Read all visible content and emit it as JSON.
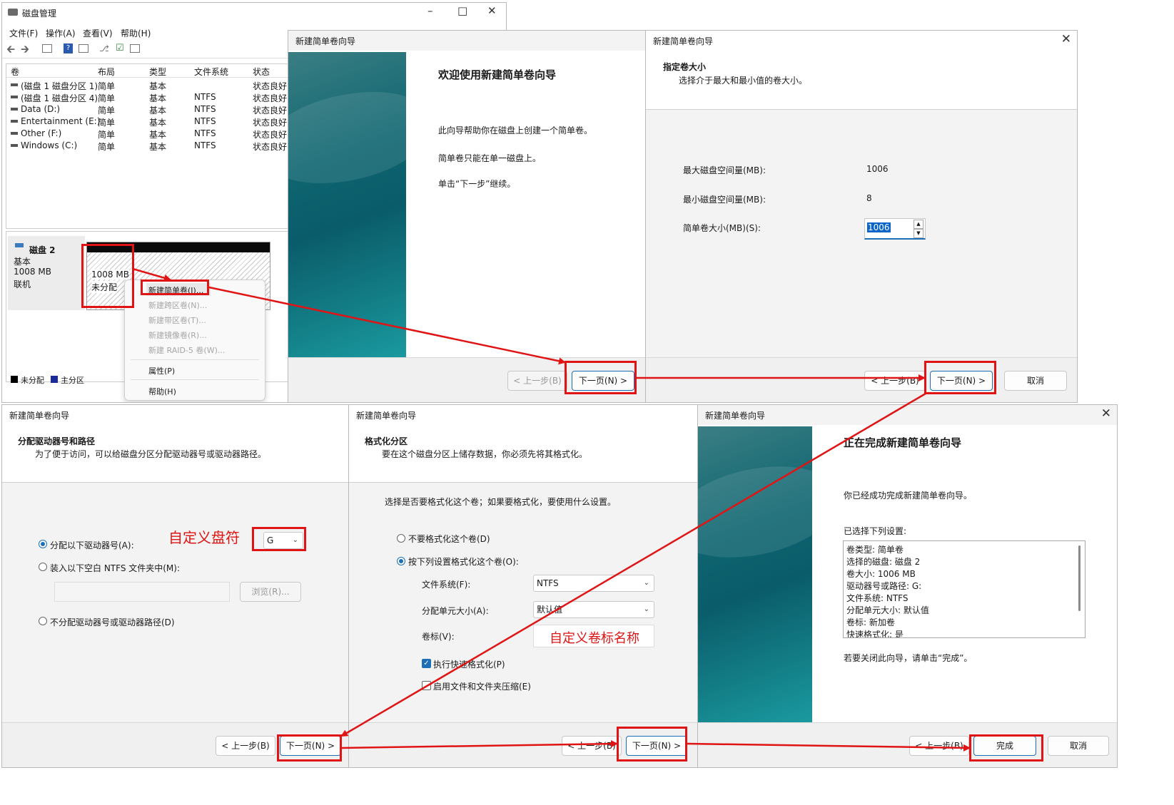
{
  "disk_mgmt": {
    "title": "磁盘管理",
    "menu": [
      "文件(F)",
      "操作(A)",
      "查看(V)",
      "帮助(H)"
    ],
    "columns": [
      "卷",
      "布局",
      "类型",
      "文件系统",
      "状态"
    ],
    "rows": [
      {
        "vol": "(磁盘 1 磁盘分区 1)",
        "layout": "简单",
        "type": "基本",
        "fs": "",
        "status": "状态良好"
      },
      {
        "vol": "(磁盘 1 磁盘分区 4)",
        "layout": "简单",
        "type": "基本",
        "fs": "NTFS",
        "status": "状态良好"
      },
      {
        "vol": "Data (D:)",
        "layout": "简单",
        "type": "基本",
        "fs": "NTFS",
        "status": "状态良好"
      },
      {
        "vol": "Entertainment (E:)",
        "layout": "简单",
        "type": "基本",
        "fs": "NTFS",
        "status": "状态良好"
      },
      {
        "vol": "Other (F:)",
        "layout": "简单",
        "type": "基本",
        "fs": "NTFS",
        "status": "状态良好"
      },
      {
        "vol": "Windows (C:)",
        "layout": "简单",
        "type": "基本",
        "fs": "NTFS",
        "status": "状态良好"
      }
    ],
    "disk": {
      "name": "磁盘 2",
      "kind": "基本",
      "size": "1008 MB",
      "state": "联机",
      "part_size": "1008 MB",
      "part_state": "未分配"
    },
    "legend": [
      "未分配",
      "主分区"
    ],
    "context_menu": [
      {
        "label": "新建简单卷(I)...",
        "enabled": true
      },
      {
        "label": "新建跨区卷(N)...",
        "enabled": false
      },
      {
        "label": "新建带区卷(T)...",
        "enabled": false
      },
      {
        "label": "新建镜像卷(R)...",
        "enabled": false
      },
      {
        "label": "新建 RAID-5 卷(W)...",
        "enabled": false
      },
      {
        "label": "属性(P)",
        "enabled": true
      },
      {
        "label": "帮助(H)",
        "enabled": true
      }
    ]
  },
  "wizard_title": "新建简单卷向导",
  "buttons": {
    "back": "< 上一步(B)",
    "next": "下一页(N) >",
    "cancel": "取消",
    "finish": "完成"
  },
  "welcome": {
    "heading": "欢迎使用新建简单卷向导",
    "p1": "此向导帮助你在磁盘上创建一个简单卷。",
    "p2": "简单卷只能在单一磁盘上。",
    "p3": "单击“下一步”继续。"
  },
  "size": {
    "heading": "指定卷大小",
    "sub": "选择介于最大和最小值的卷大小。",
    "max_label": "最大磁盘空间量(MB):",
    "max_value": "1006",
    "min_label": "最小磁盘空间量(MB):",
    "min_value": "8",
    "vol_label": "简单卷大小(MB)(S):",
    "vol_value": "1006"
  },
  "drive": {
    "heading": "分配驱动器号和路径",
    "sub": "为了便于访问，可以给磁盘分区分配驱动器号或驱动器路径。",
    "opt1": "分配以下驱动器号(A):",
    "opt1_value": "G",
    "opt2": "装入以下空白 NTFS 文件夹中(M):",
    "browse": "浏览(R)...",
    "opt3": "不分配驱动器号或驱动器路径(D)",
    "annotation": "自定义盘符"
  },
  "format": {
    "heading": "格式化分区",
    "sub": "要在这个磁盘分区上储存数据，你必须先将其格式化。",
    "question": "选择是否要格式化这个卷；如果要格式化，要使用什么设置。",
    "opt_no": "不要格式化这个卷(D)",
    "opt_yes": "按下列设置格式化这个卷(O):",
    "fs_label": "文件系统(F):",
    "fs_value": "NTFS",
    "alloc_label": "分配单元大小(A):",
    "alloc_value": "默认值",
    "vol_label": "卷标(V):",
    "vol_annotation": "自定义卷标名称",
    "quick": "执行快速格式化(P)",
    "compress": "启用文件和文件夹压缩(E)"
  },
  "complete": {
    "heading": "正在完成新建简单卷向导",
    "p1": "你已经成功完成新建简单卷向导。",
    "list_label": "已选择下列设置:",
    "settings": [
      "卷类型: 简单卷",
      "选择的磁盘: 磁盘 2",
      "卷大小: 1006 MB",
      "驱动器号或路径: G:",
      "文件系统: NTFS",
      "分配单元大小: 默认值",
      "卷标: 新加卷",
      "快速格式化: 是"
    ],
    "p2": "若要关闭此向导，请单击“完成”。"
  },
  "colors": {
    "annotation_red": "#e01414",
    "accent": "#1c6fb6",
    "teal": "#0e6570"
  }
}
